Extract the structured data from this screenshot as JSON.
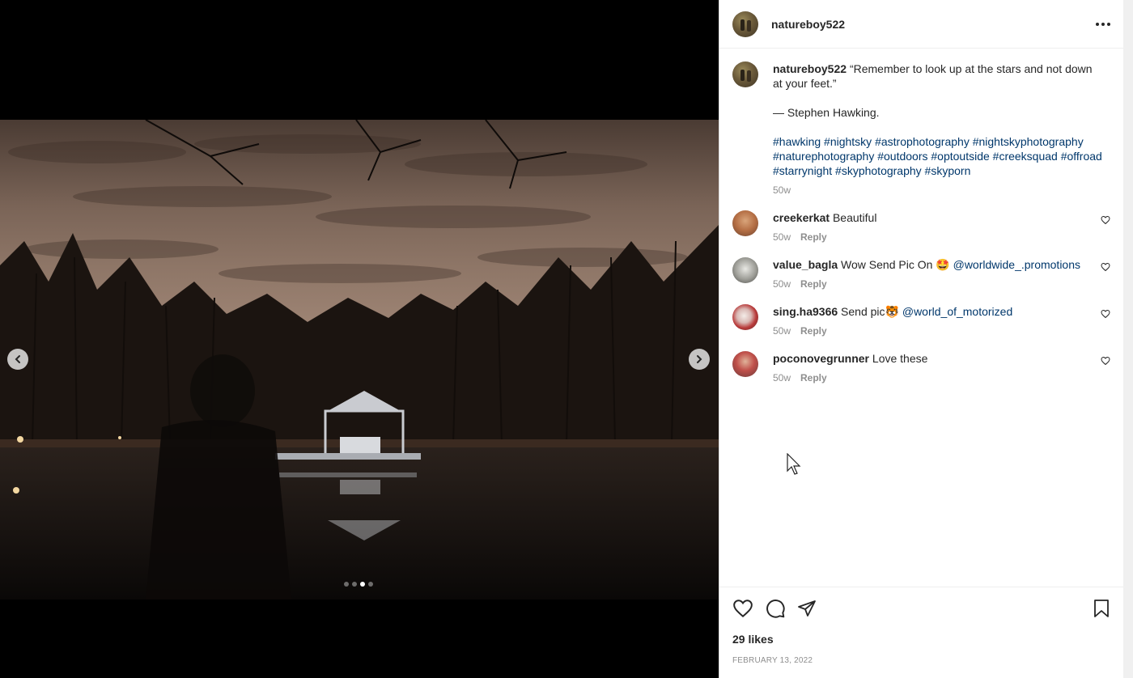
{
  "post": {
    "username": "natureboy522",
    "caption_username": "natureboy522",
    "caption_quote": "“Remember to look up at the stars and not down at your feet.”",
    "caption_author": "— Stephen Hawking.",
    "hashtags": "#hawking #nightsky #astrophotography #nightskyphotography #naturephotography #outdoors #optoutside #creeksquad #offroad #starrynight #skyphotography #skyporn",
    "caption_time": "50w",
    "likes": "29 likes",
    "date": "FEBRUARY 13, 2022",
    "carousel": {
      "count": 4,
      "active": 3
    }
  },
  "comments": [
    {
      "user": "creekerkat",
      "text": "Beautiful",
      "mention": "",
      "time": "50w",
      "reply": "Reply"
    },
    {
      "user": "value_bagla",
      "text": "Wow Send Pic On 🤩",
      "mention": "@worldwide_.promotions",
      "time": "50w",
      "reply": "Reply"
    },
    {
      "user": "sing.ha9366",
      "text": "Send pic🐯",
      "mention": "@world_of_motorized",
      "time": "50w",
      "reply": "Reply"
    },
    {
      "user": "poconovegrunner",
      "text": "Love these",
      "mention": "",
      "time": "50w",
      "reply": "Reply"
    }
  ],
  "icons": {
    "prev": "chevron-left-icon",
    "next": "chevron-right-icon",
    "more": "more-horizontal-icon",
    "like": "heart-icon",
    "comment": "comment-icon",
    "share": "send-icon",
    "save": "bookmark-icon"
  }
}
